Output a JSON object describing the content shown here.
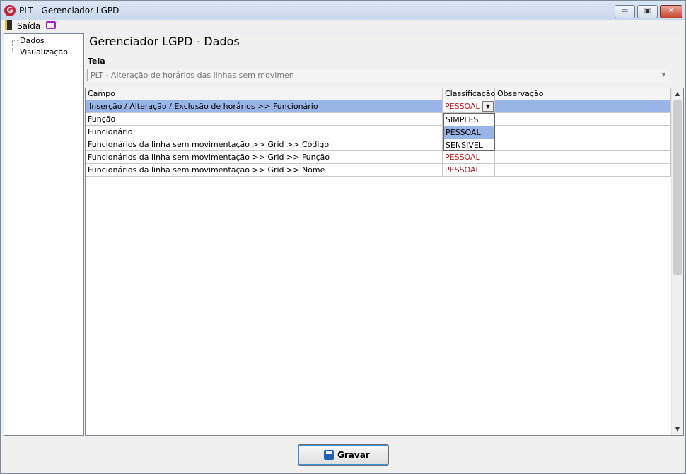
{
  "window": {
    "title": "PLT - Gerenciador LGPD",
    "logo_text": "G"
  },
  "window_controls": {
    "minimize": "▭",
    "maximize": "▣",
    "close": "✕"
  },
  "menubar": {
    "exit_label": "Saída",
    "exit_icon": "door-exit-icon",
    "monitor_icon": "monitor-icon"
  },
  "tree": {
    "items": [
      {
        "label": "Dados"
      },
      {
        "label": "Visualização"
      }
    ]
  },
  "main": {
    "title": "Gerenciador LGPD - Dados",
    "tela_label": "Tela",
    "tela_value": "PLT - Alteração de horários das linhas sem movimen"
  },
  "grid": {
    "headers": {
      "campo": "Campo",
      "classificacao": "Classificação",
      "observacao": "Observação"
    },
    "rows": [
      {
        "campo": "Inserção / Alteração / Exclusão de horários >> Funcionário",
        "classificacao": "PESSOAL",
        "observacao": ""
      },
      {
        "campo": "Função",
        "classificacao": "",
        "observacao": ""
      },
      {
        "campo": "Funcionário",
        "classificacao": "",
        "observacao": ""
      },
      {
        "campo": "Funcionários da linha sem movimentação >> Grid >> Código",
        "classificacao": "",
        "observacao": ""
      },
      {
        "campo": "Funcionários da linha sem movimentação >> Grid >> Função",
        "classificacao": "PESSOAL",
        "observacao": ""
      },
      {
        "campo": "Funcionários da linha sem movimentação >> Grid >> Nome",
        "classificacao": "PESSOAL",
        "observacao": ""
      }
    ],
    "selected_row": 0,
    "dropdown_options": [
      "SIMPLES",
      "PESSOAL",
      "SENSÍVEL"
    ],
    "dropdown_active": "PESSOAL"
  },
  "footer": {
    "save_label": "Gravar"
  },
  "colors": {
    "selection": "#99b4e6",
    "classification_text": "#c1121c",
    "monitor_icon": "#a41fd1"
  }
}
